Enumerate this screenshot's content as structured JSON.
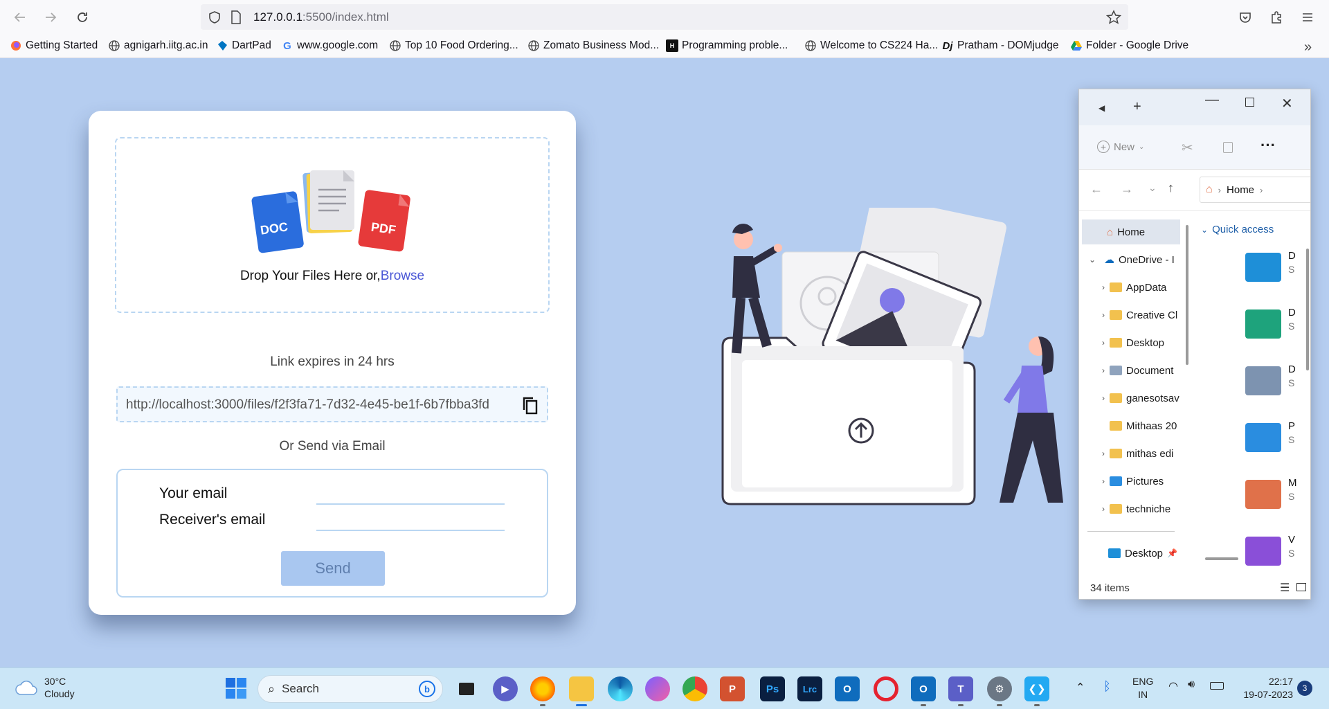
{
  "browser": {
    "url_host": "127.0.0.1",
    "url_path": ":5500/index.html",
    "bookmarks": [
      "Getting Started",
      "agnigarh.iitg.ac.in",
      "DartPad",
      "www.google.com",
      "Top 10 Food Ordering...",
      "Zomato Business Mod...",
      "Programming proble...",
      "Welcome to CS224 Ha...",
      "Pratham - DOMjudge",
      "Folder - Google Drive"
    ]
  },
  "upload": {
    "doc_badge": "DOC",
    "pdf_badge": "PDF",
    "drop_text": "Drop Your Files Here or,",
    "browse_link": "Browse",
    "expire_text": "Link expires in 24 hrs",
    "share_link": "http://localhost:3000/files/f2f3fa71-7d32-4e45-be1f-6b7fbba3fd",
    "or_email_text": "Or Send via Email",
    "your_email_label": "Your email",
    "receiver_email_label": "Receiver's email",
    "your_email_value": "",
    "receiver_email_value": "",
    "send_label": "Send"
  },
  "explorer": {
    "new_label": "New",
    "breadcrumb": "Home",
    "nav": [
      {
        "label": "Home",
        "selected": true
      },
      {
        "label": "OneDrive - I"
      },
      {
        "label": "AppData"
      },
      {
        "label": "Creative Cl"
      },
      {
        "label": "Desktop"
      },
      {
        "label": "Document"
      },
      {
        "label": "ganesotsav"
      },
      {
        "label": "Mithaas 20"
      },
      {
        "label": "mithas edi"
      },
      {
        "label": "Pictures"
      },
      {
        "label": "techniche"
      },
      {
        "label": "Desktop"
      }
    ],
    "quick_access_label": "Quick access",
    "quick_access": [
      {
        "initial": "D",
        "sub": "S",
        "color": "#1e8fd8"
      },
      {
        "initial": "D",
        "sub": "S",
        "color": "#1ea37c"
      },
      {
        "initial": "D",
        "sub": "S",
        "color": "#7d93b0"
      },
      {
        "initial": "P",
        "sub": "S",
        "color": "#2a8de0"
      },
      {
        "initial": "M",
        "sub": "S",
        "color": "#e0714a"
      },
      {
        "initial": "V",
        "sub": "S",
        "color": "#8a4fd8"
      }
    ],
    "status": "34 items"
  },
  "taskbar": {
    "temp": "30°C",
    "weather": "Cloudy",
    "search_label": "Search",
    "lang_1": "ENG",
    "lang_2": "IN",
    "time": "22:17",
    "date": "19-07-2023",
    "notification_count": "3",
    "apps": [
      {
        "name": "ps",
        "text": "Ps",
        "color": "#0a1f40"
      },
      {
        "name": "lrc",
        "text": "Lrc",
        "color": "#0a1f40"
      }
    ]
  }
}
